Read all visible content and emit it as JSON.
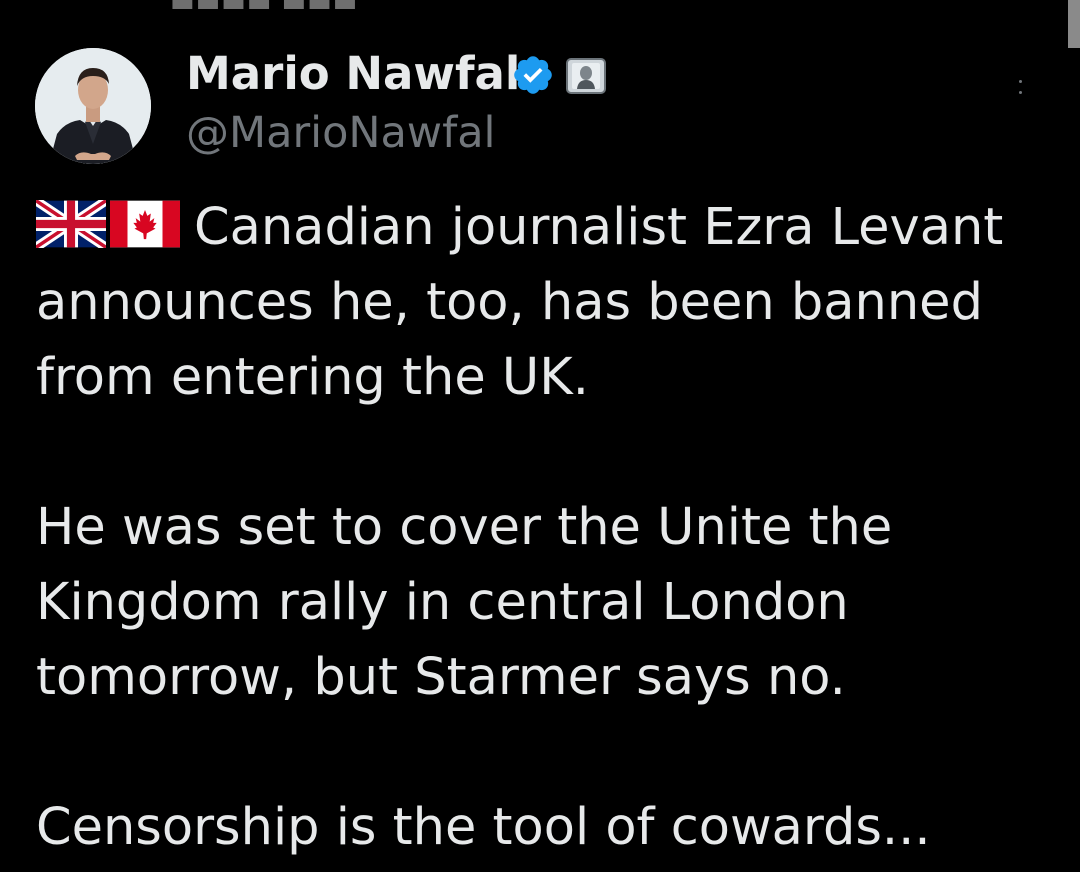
{
  "author": {
    "display_name": "Mario Nawfal",
    "handle": "@MarioNawfal",
    "avatar_icon": "profile-photo",
    "badges": [
      "verified-badge-icon",
      "affiliate-badge-icon"
    ],
    "verified_color": "#1d9bf0"
  },
  "tweet": {
    "flags": [
      "uk-flag-icon",
      "canada-flag-icon"
    ],
    "paragraph_1": "Canadian journalist Ezra Levant announces he, too, has been banned from entering the UK.",
    "paragraph_2": "He was set to cover the Unite the Kingdom rally in central London tomorrow, but Starmer says no.",
    "paragraph_3": "Censorship is the tool of cowards..."
  },
  "colors": {
    "background": "#000000",
    "text_primary": "#e7e9ea",
    "text_secondary": "#71767b"
  }
}
